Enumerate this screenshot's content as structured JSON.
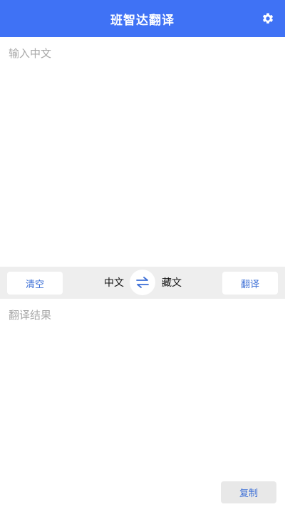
{
  "header": {
    "title": "班智达翻译",
    "settings_icon": "gear-icon"
  },
  "input": {
    "placeholder": "输入中文",
    "value": ""
  },
  "toolbar": {
    "clear_label": "清空",
    "source_lang": "中文",
    "swap_icon": "swap-arrows-icon",
    "target_lang": "藏文",
    "translate_label": "翻译"
  },
  "result": {
    "placeholder": "翻译结果",
    "value": ""
  },
  "copy_label": "复制",
  "colors": {
    "header_bg": "#3f72f5",
    "accent": "#3d6fd6",
    "toolbar_bg": "#eeeeee"
  }
}
